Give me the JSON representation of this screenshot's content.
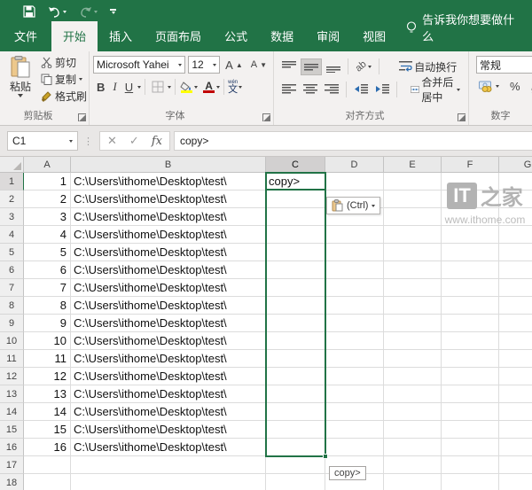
{
  "titlebar": {
    "qat": {
      "save": "save",
      "undo": "undo",
      "redo": "redo",
      "customize": "customize-quick-access"
    }
  },
  "tabs": {
    "file": "文件",
    "items": [
      {
        "label": "开始",
        "active": true
      },
      {
        "label": "插入",
        "active": false
      },
      {
        "label": "页面布局",
        "active": false
      },
      {
        "label": "公式",
        "active": false
      },
      {
        "label": "数据",
        "active": false
      },
      {
        "label": "审阅",
        "active": false
      },
      {
        "label": "视图",
        "active": false
      }
    ],
    "tell_me": "告诉我你想要做什么"
  },
  "ribbon": {
    "clipboard": {
      "label": "剪贴板",
      "paste": "粘贴",
      "cut": "剪切",
      "copy": "复制",
      "format_painter": "格式刷"
    },
    "font": {
      "label": "字体",
      "name": "Microsoft Yahei",
      "size": "12",
      "bold": "B",
      "italic": "I",
      "underline": "U",
      "phonetic_small": "wén",
      "phonetic": "文"
    },
    "alignment": {
      "label": "对齐方式",
      "orientation": "ab",
      "wrap": "自动换行",
      "merge": "合并后居中"
    },
    "number": {
      "label": "数字",
      "format": "常规",
      "percent": "%",
      "comma": ","
    }
  },
  "formula_bar": {
    "name_box": "C1",
    "cancel": "✕",
    "enter": "✓",
    "fx": "fx",
    "value": "copy>"
  },
  "grid": {
    "col_headers": [
      "A",
      "B",
      "C",
      "D",
      "E",
      "F",
      "G"
    ],
    "selected_col": "C",
    "active_row": "1",
    "rows": [
      {
        "n": "1",
        "A": "1",
        "B": "C:\\Users\\ithome\\Desktop\\test\\",
        "C": "copy>"
      },
      {
        "n": "2",
        "A": "2",
        "B": "C:\\Users\\ithome\\Desktop\\test\\"
      },
      {
        "n": "3",
        "A": "3",
        "B": "C:\\Users\\ithome\\Desktop\\test\\"
      },
      {
        "n": "4",
        "A": "4",
        "B": "C:\\Users\\ithome\\Desktop\\test\\"
      },
      {
        "n": "5",
        "A": "5",
        "B": "C:\\Users\\ithome\\Desktop\\test\\"
      },
      {
        "n": "6",
        "A": "6",
        "B": "C:\\Users\\ithome\\Desktop\\test\\"
      },
      {
        "n": "7",
        "A": "7",
        "B": "C:\\Users\\ithome\\Desktop\\test\\"
      },
      {
        "n": "8",
        "A": "8",
        "B": "C:\\Users\\ithome\\Desktop\\test\\"
      },
      {
        "n": "9",
        "A": "9",
        "B": "C:\\Users\\ithome\\Desktop\\test\\"
      },
      {
        "n": "10",
        "A": "10",
        "B": "C:\\Users\\ithome\\Desktop\\test\\"
      },
      {
        "n": "11",
        "A": "11",
        "B": "C:\\Users\\ithome\\Desktop\\test\\"
      },
      {
        "n": "12",
        "A": "12",
        "B": "C:\\Users\\ithome\\Desktop\\test\\"
      },
      {
        "n": "13",
        "A": "13",
        "B": "C:\\Users\\ithome\\Desktop\\test\\"
      },
      {
        "n": "14",
        "A": "14",
        "B": "C:\\Users\\ithome\\Desktop\\test\\"
      },
      {
        "n": "15",
        "A": "15",
        "B": "C:\\Users\\ithome\\Desktop\\test\\"
      },
      {
        "n": "16",
        "A": "16",
        "B": "C:\\Users\\ithome\\Desktop\\test\\"
      },
      {
        "n": "17"
      },
      {
        "n": "18"
      }
    ]
  },
  "overlays": {
    "paste_options_label": "(Ctrl)",
    "fill_tooltip": "copy>",
    "watermark_logo_left": "IT",
    "watermark_logo_right": "之家",
    "watermark_url": "www.ithome.com"
  },
  "colors": {
    "accent": "#217346",
    "fill_yellow": "#ffff00",
    "font_red": "#c00000"
  }
}
